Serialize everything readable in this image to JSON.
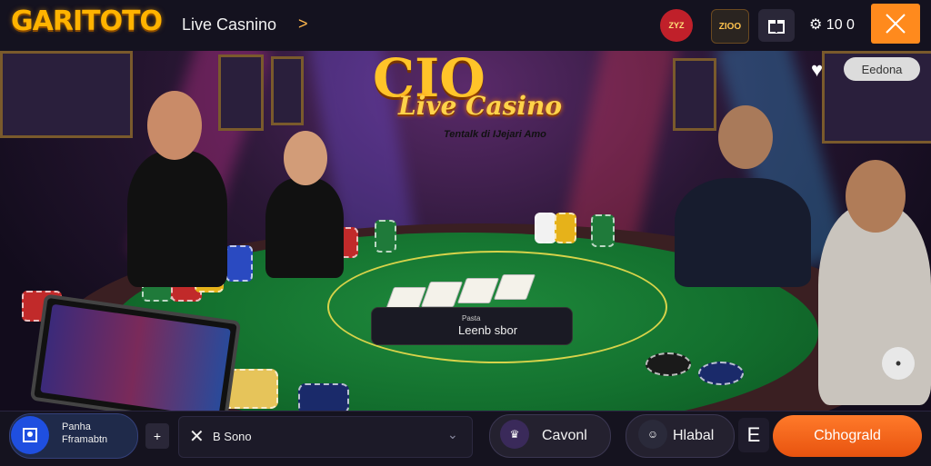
{
  "header": {
    "logo": "GARITOTO",
    "breadcrumb": "Live Casnino",
    "breadcrumb_chevron": ">",
    "badge_1": "ZYZ",
    "badge_2": "ZIOO",
    "coin_count": "10 0",
    "close_label": "X"
  },
  "hero": {
    "title_big": "CIO",
    "title_script": "Live Casino",
    "subtitle": "Tentalk di IJejari Amo",
    "favorite_icon": "heart-icon",
    "edit_pill": "Eedona",
    "info_pill_small": "Pasta",
    "info_pill_label": "Leenb sbor"
  },
  "footer": {
    "account_line1": "Panha",
    "account_line2": "Fframabtn",
    "plus_label": "+",
    "search_value": "B Sono",
    "pill_1": "Cavonl",
    "pill_2": "Hlabal",
    "e_label": "E",
    "cta": "Cbhograld"
  },
  "colors": {
    "accent_orange": "#ff8a1d",
    "felt_green": "#13702e",
    "logo_gold": "#ffb300"
  }
}
